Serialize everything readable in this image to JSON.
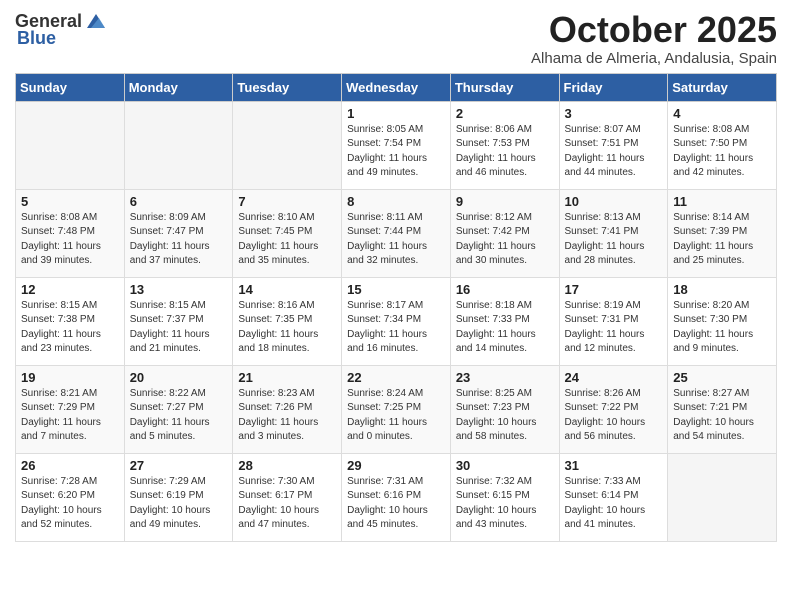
{
  "header": {
    "logo_general": "General",
    "logo_blue": "Blue",
    "month_title": "October 2025",
    "subtitle": "Alhama de Almeria, Andalusia, Spain"
  },
  "weekdays": [
    "Sunday",
    "Monday",
    "Tuesday",
    "Wednesday",
    "Thursday",
    "Friday",
    "Saturday"
  ],
  "weeks": [
    [
      {
        "day": "",
        "info": ""
      },
      {
        "day": "",
        "info": ""
      },
      {
        "day": "",
        "info": ""
      },
      {
        "day": "1",
        "info": "Sunrise: 8:05 AM\nSunset: 7:54 PM\nDaylight: 11 hours\nand 49 minutes."
      },
      {
        "day": "2",
        "info": "Sunrise: 8:06 AM\nSunset: 7:53 PM\nDaylight: 11 hours\nand 46 minutes."
      },
      {
        "day": "3",
        "info": "Sunrise: 8:07 AM\nSunset: 7:51 PM\nDaylight: 11 hours\nand 44 minutes."
      },
      {
        "day": "4",
        "info": "Sunrise: 8:08 AM\nSunset: 7:50 PM\nDaylight: 11 hours\nand 42 minutes."
      }
    ],
    [
      {
        "day": "5",
        "info": "Sunrise: 8:08 AM\nSunset: 7:48 PM\nDaylight: 11 hours\nand 39 minutes."
      },
      {
        "day": "6",
        "info": "Sunrise: 8:09 AM\nSunset: 7:47 PM\nDaylight: 11 hours\nand 37 minutes."
      },
      {
        "day": "7",
        "info": "Sunrise: 8:10 AM\nSunset: 7:45 PM\nDaylight: 11 hours\nand 35 minutes."
      },
      {
        "day": "8",
        "info": "Sunrise: 8:11 AM\nSunset: 7:44 PM\nDaylight: 11 hours\nand 32 minutes."
      },
      {
        "day": "9",
        "info": "Sunrise: 8:12 AM\nSunset: 7:42 PM\nDaylight: 11 hours\nand 30 minutes."
      },
      {
        "day": "10",
        "info": "Sunrise: 8:13 AM\nSunset: 7:41 PM\nDaylight: 11 hours\nand 28 minutes."
      },
      {
        "day": "11",
        "info": "Sunrise: 8:14 AM\nSunset: 7:39 PM\nDaylight: 11 hours\nand 25 minutes."
      }
    ],
    [
      {
        "day": "12",
        "info": "Sunrise: 8:15 AM\nSunset: 7:38 PM\nDaylight: 11 hours\nand 23 minutes."
      },
      {
        "day": "13",
        "info": "Sunrise: 8:15 AM\nSunset: 7:37 PM\nDaylight: 11 hours\nand 21 minutes."
      },
      {
        "day": "14",
        "info": "Sunrise: 8:16 AM\nSunset: 7:35 PM\nDaylight: 11 hours\nand 18 minutes."
      },
      {
        "day": "15",
        "info": "Sunrise: 8:17 AM\nSunset: 7:34 PM\nDaylight: 11 hours\nand 16 minutes."
      },
      {
        "day": "16",
        "info": "Sunrise: 8:18 AM\nSunset: 7:33 PM\nDaylight: 11 hours\nand 14 minutes."
      },
      {
        "day": "17",
        "info": "Sunrise: 8:19 AM\nSunset: 7:31 PM\nDaylight: 11 hours\nand 12 minutes."
      },
      {
        "day": "18",
        "info": "Sunrise: 8:20 AM\nSunset: 7:30 PM\nDaylight: 11 hours\nand 9 minutes."
      }
    ],
    [
      {
        "day": "19",
        "info": "Sunrise: 8:21 AM\nSunset: 7:29 PM\nDaylight: 11 hours\nand 7 minutes."
      },
      {
        "day": "20",
        "info": "Sunrise: 8:22 AM\nSunset: 7:27 PM\nDaylight: 11 hours\nand 5 minutes."
      },
      {
        "day": "21",
        "info": "Sunrise: 8:23 AM\nSunset: 7:26 PM\nDaylight: 11 hours\nand 3 minutes."
      },
      {
        "day": "22",
        "info": "Sunrise: 8:24 AM\nSunset: 7:25 PM\nDaylight: 11 hours\nand 0 minutes."
      },
      {
        "day": "23",
        "info": "Sunrise: 8:25 AM\nSunset: 7:23 PM\nDaylight: 10 hours\nand 58 minutes."
      },
      {
        "day": "24",
        "info": "Sunrise: 8:26 AM\nSunset: 7:22 PM\nDaylight: 10 hours\nand 56 minutes."
      },
      {
        "day": "25",
        "info": "Sunrise: 8:27 AM\nSunset: 7:21 PM\nDaylight: 10 hours\nand 54 minutes."
      }
    ],
    [
      {
        "day": "26",
        "info": "Sunrise: 7:28 AM\nSunset: 6:20 PM\nDaylight: 10 hours\nand 52 minutes."
      },
      {
        "day": "27",
        "info": "Sunrise: 7:29 AM\nSunset: 6:19 PM\nDaylight: 10 hours\nand 49 minutes."
      },
      {
        "day": "28",
        "info": "Sunrise: 7:30 AM\nSunset: 6:17 PM\nDaylight: 10 hours\nand 47 minutes."
      },
      {
        "day": "29",
        "info": "Sunrise: 7:31 AM\nSunset: 6:16 PM\nDaylight: 10 hours\nand 45 minutes."
      },
      {
        "day": "30",
        "info": "Sunrise: 7:32 AM\nSunset: 6:15 PM\nDaylight: 10 hours\nand 43 minutes."
      },
      {
        "day": "31",
        "info": "Sunrise: 7:33 AM\nSunset: 6:14 PM\nDaylight: 10 hours\nand 41 minutes."
      },
      {
        "day": "",
        "info": ""
      }
    ]
  ]
}
